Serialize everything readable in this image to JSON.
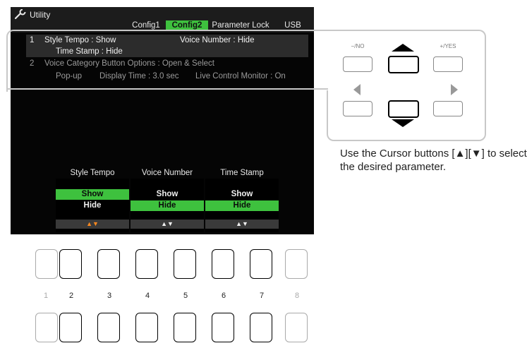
{
  "screen": {
    "title": "Utility",
    "icon": "wrench-icon",
    "tabs": [
      "Config1",
      "Config2",
      "Parameter Lock",
      "USB"
    ],
    "active_tab": "Config2",
    "rows": {
      "r1_num": "1",
      "r1_a": "Style Tempo : Show",
      "r1_b": "Voice Number : Hide",
      "r1_c": "Time Stamp : Hide",
      "r2_num": "2",
      "r2_a": "Voice Category Button Options : Open & Select",
      "r2_b1": "Pop-up",
      "r2_b2": "Display Time : 3.0 sec",
      "r2_b3": "Live Control Monitor : On"
    },
    "columns": [
      {
        "header": "Style Tempo",
        "opt1": "Show",
        "opt2": "Hide",
        "arrows": "▲▼"
      },
      {
        "header": "Voice Number",
        "opt1": "Show",
        "opt2": "Hide",
        "arrows": "▲▼"
      },
      {
        "header": "Time Stamp",
        "opt1": "Show",
        "opt2": "Hide",
        "arrows": "▲▼"
      }
    ],
    "colors": {
      "accent": "#3ec13e",
      "highlight_arrows": "#ff8a1f"
    }
  },
  "panel": {
    "no_label": "−/NO",
    "yes_label": "+/YES"
  },
  "caption": "Use the Cursor buttons [▲][▼] to select the desired parameter.",
  "number_buttons": [
    "1",
    "2",
    "3",
    "4",
    "5",
    "6",
    "7",
    "8"
  ]
}
